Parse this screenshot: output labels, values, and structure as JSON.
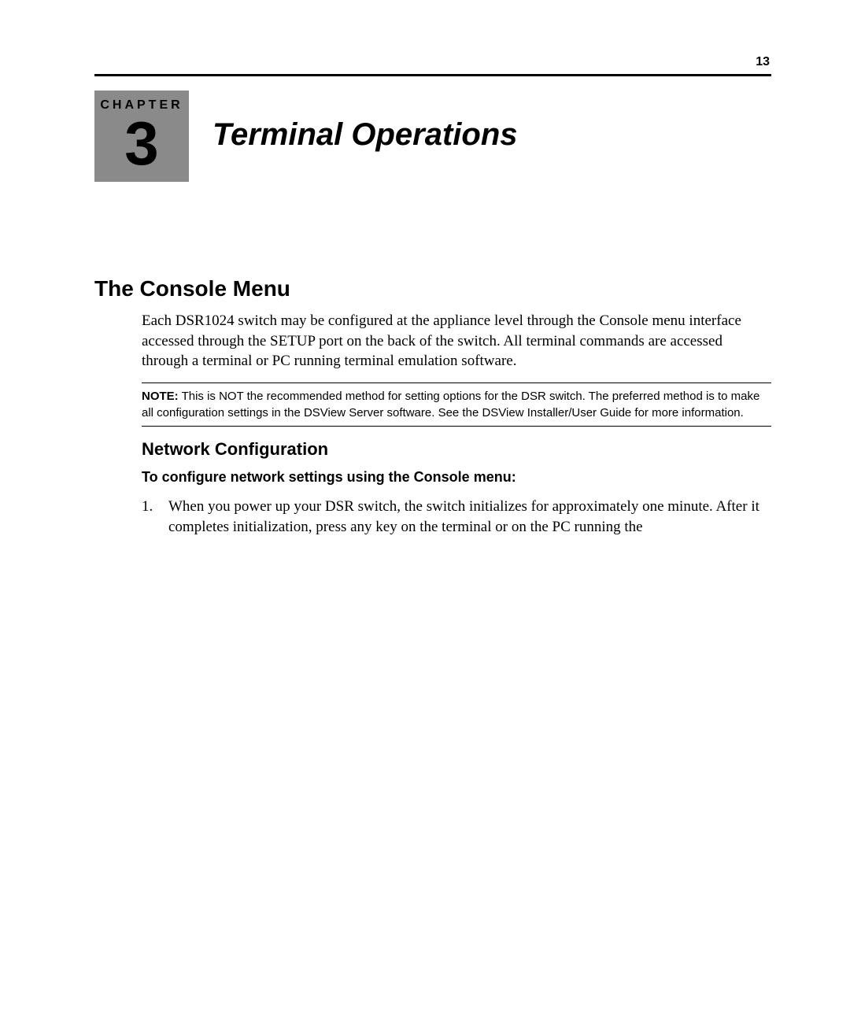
{
  "page_number": "13",
  "chapter": {
    "label": "CHAPTER",
    "number": "3",
    "title": "Terminal Operations"
  },
  "section": {
    "heading": "The Console Menu",
    "intro": "Each DSR1024 switch may be configured at the appliance level through the Console menu interface accessed through the SETUP port on the back of the switch. All terminal commands are accessed through a terminal or PC running terminal emulation software."
  },
  "note": {
    "label": "NOTE:",
    "text": " This is NOT the recommended method for setting options for the DSR switch. The preferred method is to make all configuration settings in the DSView Server software. See the DSView Installer/User Guide for more information."
  },
  "subsection": {
    "heading": "Network Configuration",
    "procedure_heading": "To configure network settings using the Console menu:",
    "steps": [
      {
        "num": "1.",
        "text": "When you power up your DSR switch, the switch initializes for approximately one minute. After it completes initialization, press any key on the terminal or on the PC running the"
      }
    ]
  }
}
